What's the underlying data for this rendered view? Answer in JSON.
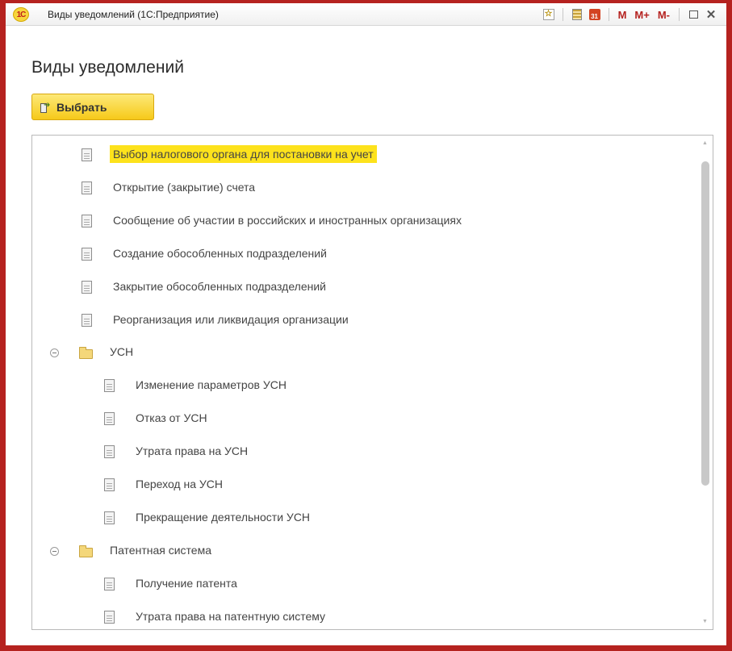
{
  "window": {
    "logo": "1С",
    "title": "Виды уведомлений  (1С:Предприятие)",
    "tools": {
      "m": "M",
      "m_plus": "M+",
      "m_minus": "M-"
    },
    "accent": "#b5221f"
  },
  "form": {
    "title": "Виды уведомлений",
    "select_button": "Выбрать"
  },
  "tree": {
    "selected_color": "#fde21c",
    "items": [
      {
        "label": "Выбор налогового органа для постановки на учет",
        "type": "doc",
        "level": 0,
        "selected": true
      },
      {
        "label": "Открытие (закрытие) счета",
        "type": "doc",
        "level": 0
      },
      {
        "label": "Сообщение об участии в российских и иностранных организациях",
        "type": "doc",
        "level": 0
      },
      {
        "label": "Создание обособленных подразделений",
        "type": "doc",
        "level": 0
      },
      {
        "label": "Закрытие обособленных подразделений",
        "type": "doc",
        "level": 0
      },
      {
        "label": "Реорганизация или ликвидация организации",
        "type": "doc",
        "level": 0
      },
      {
        "label": "УСН",
        "type": "folder",
        "level": 0,
        "expanded": true
      },
      {
        "label": "Изменение параметров УСН",
        "type": "doc",
        "level": 1
      },
      {
        "label": "Отказ от УСН",
        "type": "doc",
        "level": 1
      },
      {
        "label": "Утрата права на УСН",
        "type": "doc",
        "level": 1
      },
      {
        "label": "Переход на УСН",
        "type": "doc",
        "level": 1
      },
      {
        "label": "Прекращение деятельности УСН",
        "type": "doc",
        "level": 1
      },
      {
        "label": "Патентная система",
        "type": "folder",
        "level": 0,
        "expanded": true
      },
      {
        "label": "Получение патента",
        "type": "doc",
        "level": 1
      },
      {
        "label": "Утрата права на патентную систему",
        "type": "doc",
        "level": 1
      }
    ]
  }
}
